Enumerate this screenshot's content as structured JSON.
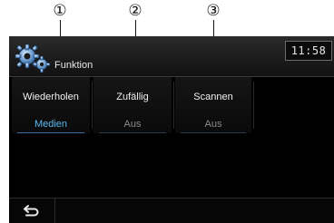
{
  "callouts": [
    "①",
    "②",
    "③"
  ],
  "header": {
    "title": "Funktion",
    "clock": "11:58"
  },
  "tiles": [
    {
      "label": "Wiederholen",
      "value": "Medien"
    },
    {
      "label": "Zufällig",
      "value": "Aus"
    },
    {
      "label": "Scannen",
      "value": "Aus"
    }
  ],
  "colors": {
    "active_value": "#58b8f0",
    "inactive_value": "#8a8a8a"
  },
  "icons": {
    "settings": "gear-icon",
    "back": "back-arrow-icon"
  }
}
